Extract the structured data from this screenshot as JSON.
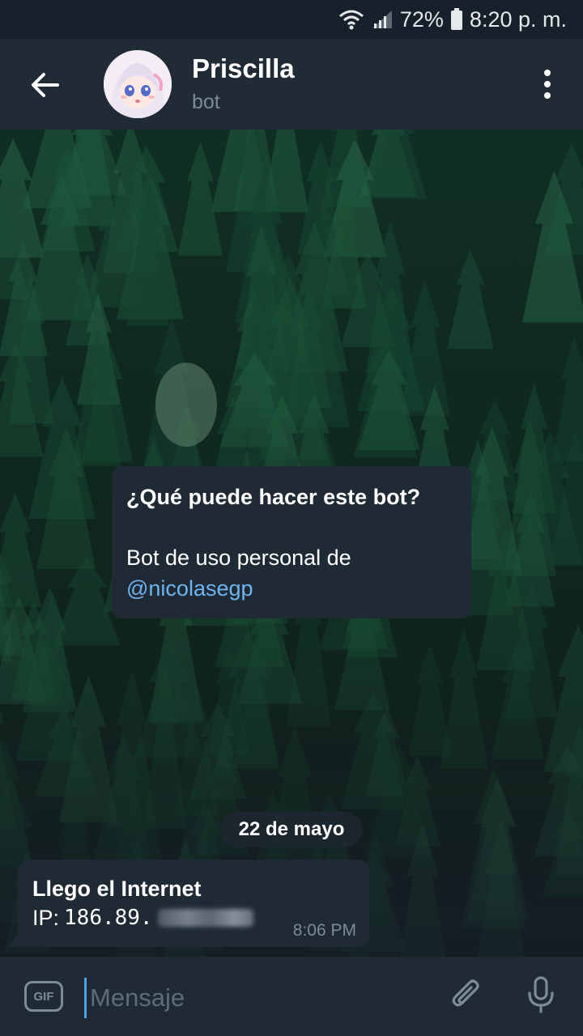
{
  "status_bar": {
    "battery": "72%",
    "time": "8:20 p. m.",
    "icons": [
      "wifi-icon",
      "signal-icon",
      "battery-icon"
    ]
  },
  "header": {
    "title": "Priscilla",
    "subtitle": "bot",
    "icons": [
      "back-arrow-icon",
      "more-vertical-icon"
    ]
  },
  "bot_info": {
    "title": "¿Qué puede hacer este bot?",
    "description": "Bot de uso personal de",
    "link": "@nicolasegp"
  },
  "date_separator": "22 de mayo",
  "message": {
    "line1": "Llego el Internet",
    "ip_label": "IP:",
    "ip_visible": "186.89.",
    "time": "8:06 PM"
  },
  "input_bar": {
    "gif_label": "GIF",
    "placeholder": "Mensaje",
    "icons": [
      "gif-icon",
      "attach-icon",
      "microphone-icon"
    ]
  },
  "colors": {
    "header_bg": "#202b36",
    "bubble_bg": "#1f2a35",
    "link": "#6eb4ee",
    "accent_cursor": "#4fa3e2",
    "muted_text": "#7d8b99"
  }
}
